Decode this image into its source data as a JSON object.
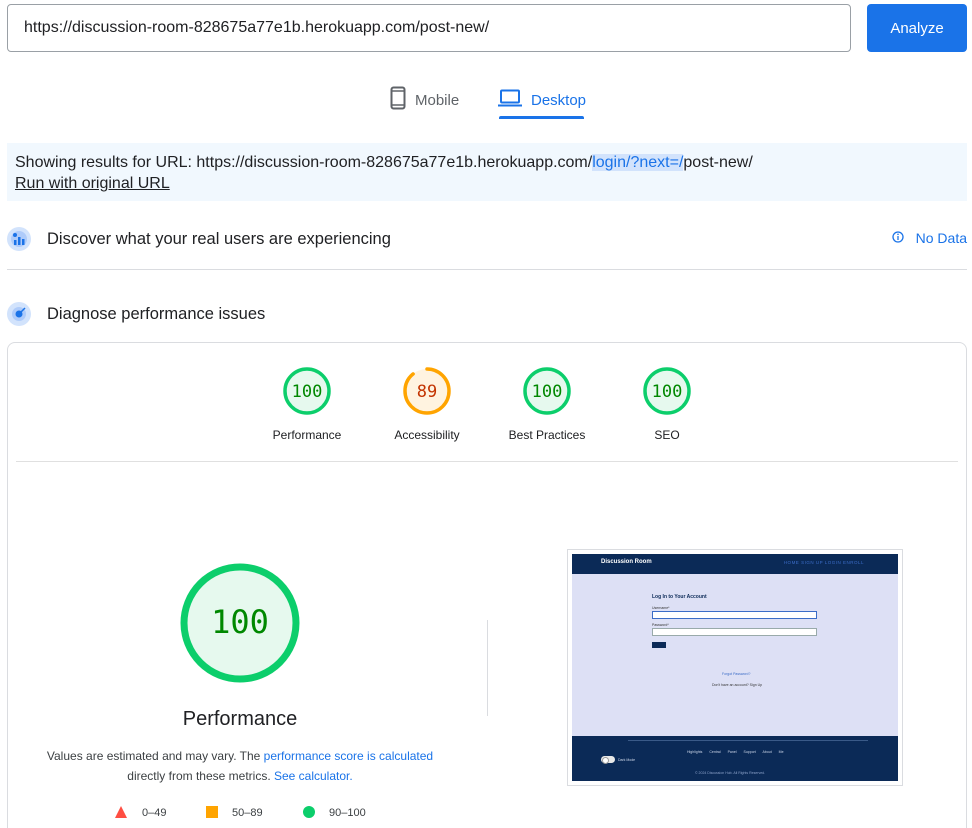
{
  "search": {
    "url_value": "https://discussion-room-828675a77e1b.herokuapp.com/post-new/",
    "analyze_label": "Analyze"
  },
  "device_tabs": {
    "mobile_label": "Mobile",
    "desktop_label": "Desktop",
    "selected": "Desktop"
  },
  "notice": {
    "prefix": "Showing results for URL: https://discussion-room-828675a77e1b.herokuapp.com/",
    "highlight": "login/?next=/",
    "suffix": "post-new/",
    "run_original_label": "Run with original URL"
  },
  "field_data": {
    "title": "Discover what your real users are experiencing",
    "status_label": "No Data",
    "icon": "field-data-icon"
  },
  "lab_data": {
    "title": "Diagnose performance issues",
    "icon": "lab-data-icon"
  },
  "scores": [
    {
      "label": "Performance",
      "value": 100,
      "color": "#0cce6b"
    },
    {
      "label": "Accessibility",
      "value": 89,
      "color": "#ffa400"
    },
    {
      "label": "Best Practices",
      "value": 100,
      "color": "#0cce6b"
    },
    {
      "label": "SEO",
      "value": 100,
      "color": "#0cce6b"
    }
  ],
  "performance_detail": {
    "score": "100",
    "title": "Performance",
    "desc_prefix": "Values are estimated and may vary. The ",
    "desc_link": "performance score is calculated",
    "desc_middle": "directly from these metrics. ",
    "desc_link2": "See calculator."
  },
  "legend": [
    {
      "range": "0–49",
      "shape": "triangle",
      "color": "#ff4e42"
    },
    {
      "range": "50–89",
      "shape": "square",
      "color": "#ffa400"
    },
    {
      "range": "90–100",
      "shape": "circle",
      "color": "#0cce6b"
    }
  ],
  "thumbnail": {
    "brand": "Discussion Room",
    "nav_links": "HOME   SIGN UP   LOGIN   ENROLL",
    "form_title": "Log In to Your Account",
    "username_label": "Username*",
    "password_label": "Password*",
    "forgot": "Forgot Password?",
    "signup_text": "Don't have an account? Sign Up",
    "footer_links": "Highlights Central Panel Support About Me",
    "dark_mode": "Dark Mode",
    "copyright": "© 2024 Discussion Hub. All Rights Reserved."
  }
}
